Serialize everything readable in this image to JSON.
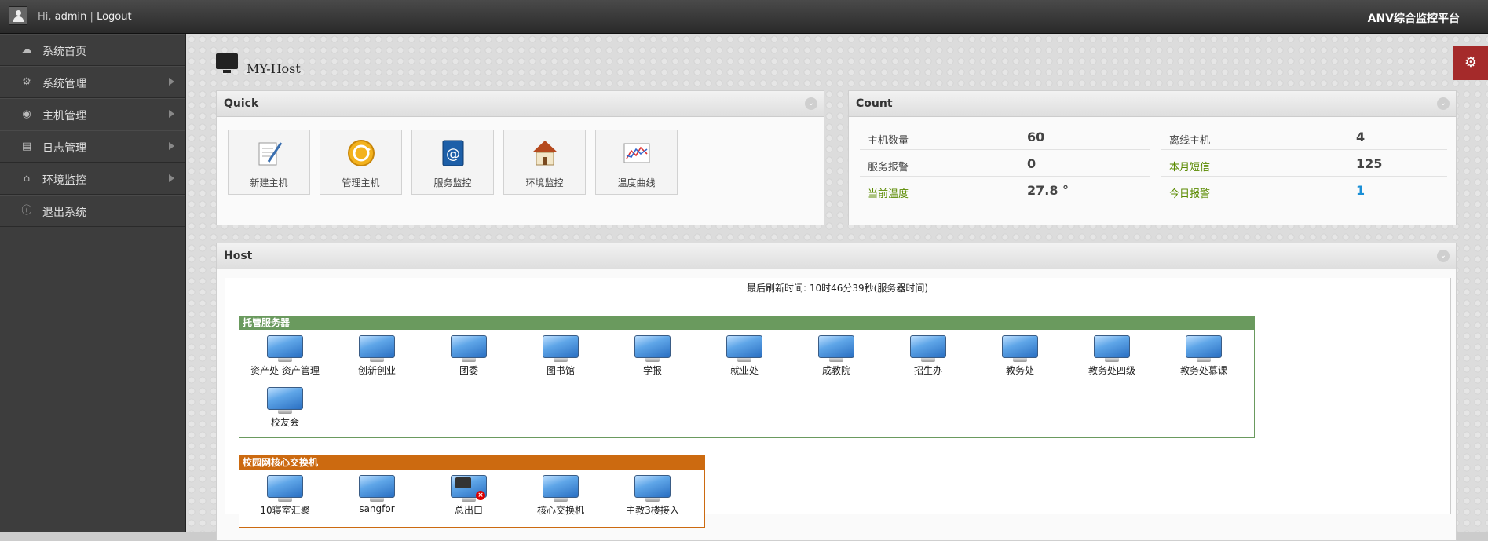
{
  "topbar": {
    "greeting": "Hi,",
    "username": "admin",
    "separator": "|",
    "logout": "Logout",
    "brand": "ANV综合监控平台"
  },
  "sidebar": {
    "items": [
      {
        "label": "系统首页",
        "icon": "home-icon",
        "has_submenu": false
      },
      {
        "label": "系统管理",
        "icon": "gears-icon",
        "has_submenu": true
      },
      {
        "label": "主机管理",
        "icon": "globe-icon",
        "has_submenu": true
      },
      {
        "label": "日志管理",
        "icon": "book-icon",
        "has_submenu": true
      },
      {
        "label": "环境监控",
        "icon": "house-icon",
        "has_submenu": true
      },
      {
        "label": "退出系统",
        "icon": "info-icon",
        "has_submenu": false
      }
    ]
  },
  "page": {
    "title": "MY-Host"
  },
  "quick": {
    "title": "Quick",
    "items": [
      {
        "label": "新建主机",
        "icon": "new-document-icon"
      },
      {
        "label": "管理主机",
        "icon": "refresh-icon"
      },
      {
        "label": "服务监控",
        "icon": "address-book-icon"
      },
      {
        "label": "环境监控",
        "icon": "house-icon"
      },
      {
        "label": "温度曲线",
        "icon": "line-chart-icon"
      }
    ]
  },
  "count": {
    "title": "Count",
    "rows": [
      {
        "k1": "主机数量",
        "v1": "60",
        "k2": "离线主机",
        "v2": "4",
        "k1_green": false,
        "k2_green": false,
        "v2_blue": false
      },
      {
        "k1": "服务报警",
        "v1": "0",
        "k2": "本月短信",
        "v2": "125",
        "k1_green": false,
        "k2_green": true,
        "v2_blue": false
      },
      {
        "k1": "当前温度",
        "v1": "27.8 °",
        "k2": "今日报警",
        "v2": "1",
        "k1_green": true,
        "k2_green": true,
        "v2_blue": true
      }
    ],
    "colors": {
      "green": "#5a8a00",
      "blue": "#1a8fd6"
    }
  },
  "host": {
    "title": "Host",
    "refresh_text": "最后刷新时间: 10时46分39秒(服务器时间)",
    "groups": [
      {
        "name": "托管服务器",
        "color": "#6a9a5e",
        "hosts": [
          "资产处 资产管理",
          "创新创业",
          "团委",
          "图书馆",
          "学报",
          "就业处",
          "成教院",
          "招生办",
          "教务处",
          "教务处四级",
          "教务处慕课",
          "校友会"
        ]
      },
      {
        "name": "校园网核心交换机",
        "color": "#cc6a10",
        "hosts": [
          "10寝室汇聚",
          "sangfor",
          "总出口",
          "核心交换机",
          "主教3楼接入"
        ],
        "error_index": 2
      }
    ]
  }
}
